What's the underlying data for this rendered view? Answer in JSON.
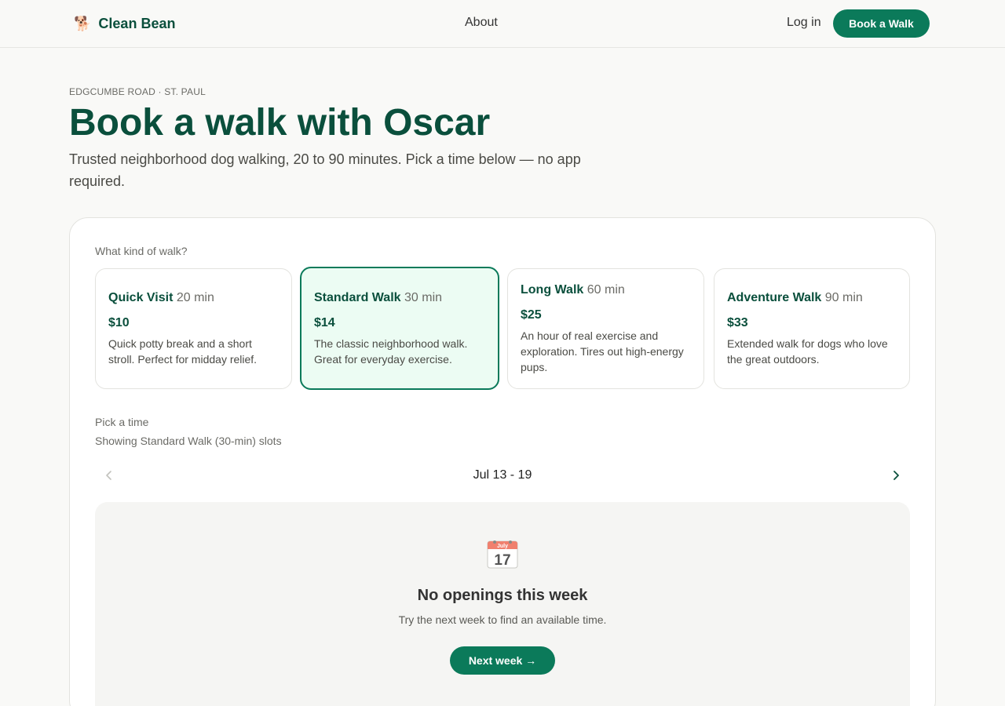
{
  "header": {
    "brand": "Clean Bean",
    "about": "About",
    "login": "Log in",
    "cta": "Book a Walk"
  },
  "hero": {
    "eyebrow": "EDGCUMBE ROAD · ST. PAUL",
    "title": "Book a walk with Oscar",
    "subtitle": "Trusted neighborhood dog walking, 20 to 90 minutes. Pick a time below — no app required."
  },
  "booking": {
    "walk_label": "What kind of walk?",
    "walks": [
      {
        "name": "Quick Visit",
        "duration": "20 min",
        "price": "$10",
        "description": "Quick potty break and a short stroll. Perfect for midday relief."
      },
      {
        "name": "Standard Walk",
        "duration": "30 min",
        "price": "$14",
        "description": "The classic neighborhood walk. Great for everyday exercise."
      },
      {
        "name": "Long Walk",
        "duration": "60 min",
        "price": "$25",
        "description": "An hour of real exercise and exploration. Tires out high-energy pups."
      },
      {
        "name": "Adventure Walk",
        "duration": "90 min",
        "price": "$33",
        "description": "Extended walk for dogs who love the great outdoors."
      }
    ],
    "selected_walk": "Standard Walk",
    "time_label": "Pick a time",
    "time_hint": "Showing Standard Walk (30-min) slots",
    "week": "Jul 13 - 19",
    "calendar_month": "July",
    "calendar_day": "17",
    "empty_title": "No openings this week",
    "empty_sub": "Try the next week to find an available time.",
    "next_week": "Next week →"
  },
  "colors": {
    "brand": "#0a4f3c",
    "accent": "#0b7a5a",
    "selected_bg": "#ecfcf3"
  },
  "icons": {
    "brand": "dog-icon",
    "prev": "chevron-left-icon",
    "next": "chevron-right-icon",
    "empty": "calendar-icon"
  }
}
